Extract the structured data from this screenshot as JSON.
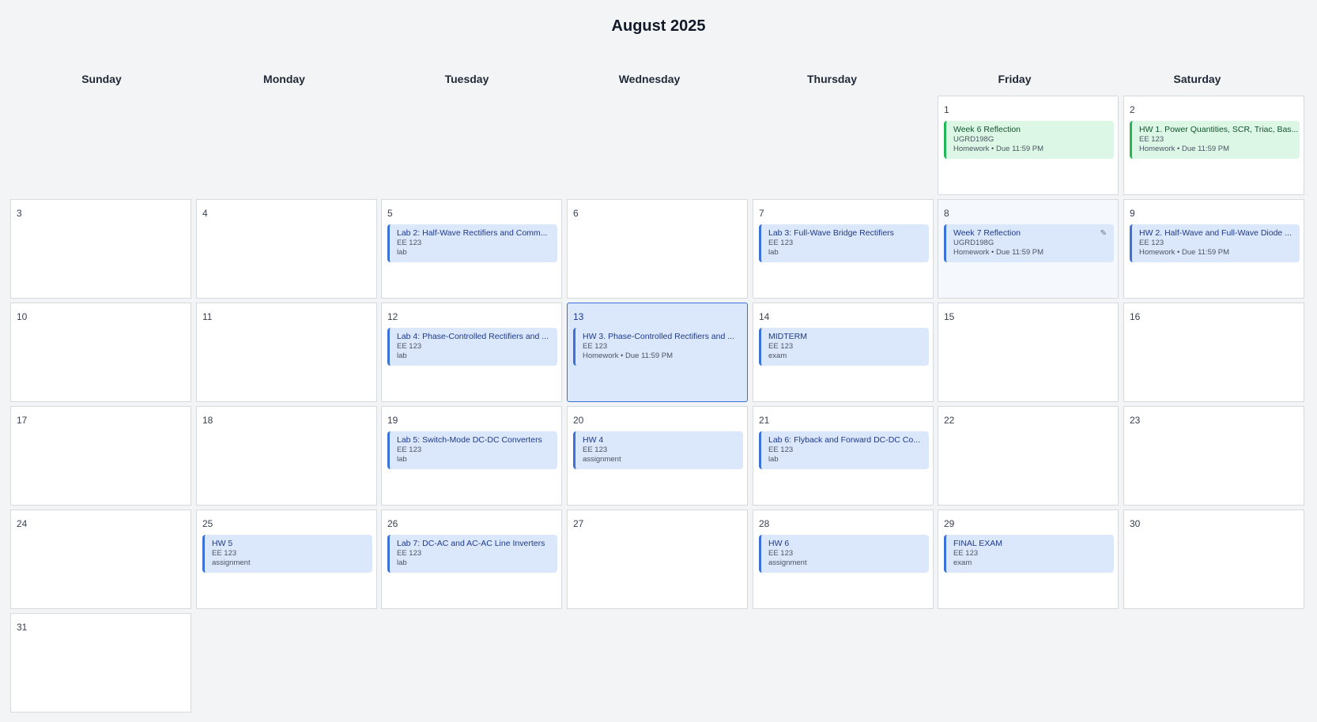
{
  "calendar": {
    "month_title": "August 2025",
    "weekdays": [
      "Sunday",
      "Monday",
      "Tuesday",
      "Wednesday",
      "Thursday",
      "Friday",
      "Saturday"
    ],
    "today": "13",
    "days": {
      "d1": "1",
      "d2": "2",
      "d3": "3",
      "d4": "4",
      "d5": "5",
      "d6": "6",
      "d7": "7",
      "d8": "8",
      "d9": "9",
      "d10": "10",
      "d11": "11",
      "d12": "12",
      "d13": "13",
      "d14": "14",
      "d15": "15",
      "d16": "16",
      "d17": "17",
      "d18": "18",
      "d19": "19",
      "d20": "20",
      "d21": "21",
      "d22": "22",
      "d23": "23",
      "d24": "24",
      "d25": "25",
      "d26": "26",
      "d27": "27",
      "d28": "28",
      "d29": "29",
      "d30": "30",
      "d31": "31"
    },
    "events": {
      "e1": {
        "title": "Week 6 Reflection",
        "course": "UGRD198G",
        "meta": "Homework • Due 11:59 PM",
        "color": "#22b857"
      },
      "e2": {
        "title": "HW 1. Power Quantities, SCR, Triac, Bas...",
        "course": "EE 123",
        "meta": "Homework • Due 11:59 PM",
        "color": "#22b857"
      },
      "e5": {
        "title": "Lab 2: Half-Wave Rectifiers and Comm...",
        "course": "EE 123",
        "meta": "lab",
        "color": "#3b72d9"
      },
      "e7": {
        "title": "Lab 3: Full-Wave Bridge Rectifiers",
        "course": "EE 123",
        "meta": "lab",
        "color": "#3b72d9"
      },
      "e8": {
        "title": "Week 7 Reflection",
        "course": "UGRD198G",
        "meta": "Homework • Due 11:59 PM",
        "color": "#3b72d9",
        "icon": "pencil-edit-icon"
      },
      "e9": {
        "title": "HW 2. Half-Wave and Full-Wave Diode ...",
        "course": "EE 123",
        "meta": "Homework • Due 11:59 PM",
        "color": "#3b72d9"
      },
      "e12": {
        "title": "Lab 4: Phase-Controlled Rectifiers and ...",
        "course": "EE 123",
        "meta": "lab",
        "color": "#3b72d9"
      },
      "e13": {
        "title": "HW 3. Phase-Controlled Rectifiers and ...",
        "course": "EE 123",
        "meta": "Homework • Due 11:59 PM",
        "color": "#3b72d9"
      },
      "e14": {
        "title": "MIDTERM",
        "course": "EE 123",
        "meta": "exam",
        "color": "#3b72d9"
      },
      "e19": {
        "title": "Lab 5: Switch-Mode DC-DC Converters",
        "course": "EE 123",
        "meta": "lab",
        "color": "#3b72d9"
      },
      "e20": {
        "title": "HW 4",
        "course": "EE 123",
        "meta": "assignment",
        "color": "#3b72d9"
      },
      "e21": {
        "title": "Lab 6: Flyback and Forward DC-DC Co...",
        "course": "EE 123",
        "meta": "lab",
        "color": "#3b72d9"
      },
      "e25": {
        "title": "HW 5",
        "course": "EE 123",
        "meta": "assignment",
        "color": "#3b72d9"
      },
      "e26": {
        "title": "Lab 7: DC-AC and AC-AC Line Inverters",
        "course": "EE 123",
        "meta": "lab",
        "color": "#3b72d9"
      },
      "e28": {
        "title": "HW 6",
        "course": "EE 123",
        "meta": "assignment",
        "color": "#3b72d9"
      },
      "e29": {
        "title": "FINAL EXAM",
        "course": "EE 123",
        "meta": "exam",
        "color": "#3b72d9"
      }
    }
  }
}
